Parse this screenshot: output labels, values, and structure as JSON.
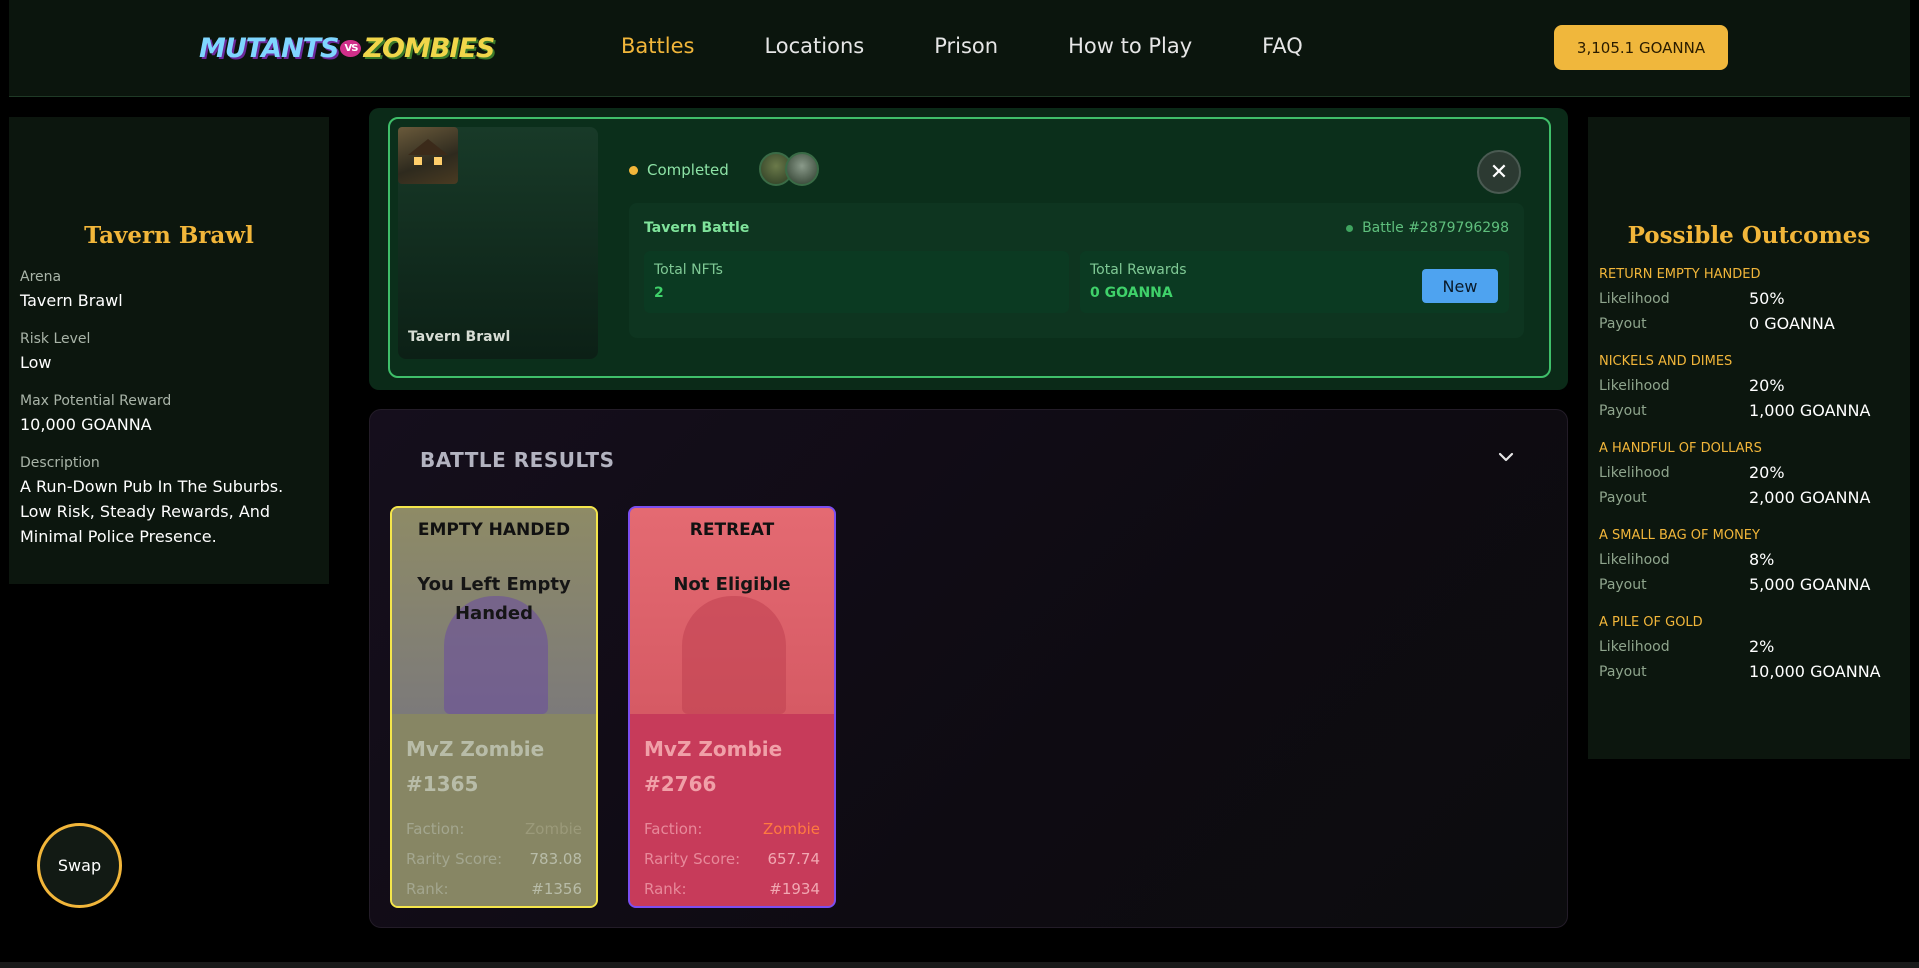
{
  "header": {
    "logo": {
      "part1": "MUTANTS",
      "part2": "VS",
      "part3": "ZOMBIES"
    },
    "nav": [
      {
        "label": "Battles",
        "active": true
      },
      {
        "label": "Locations",
        "active": false
      },
      {
        "label": "Prison",
        "active": false
      },
      {
        "label": "How to Play",
        "active": false
      },
      {
        "label": "FAQ",
        "active": false
      }
    ],
    "balance": "3,105.1 GOANNA"
  },
  "arena_panel": {
    "title": "Tavern Brawl",
    "arena_label": "Arena",
    "arena_value": "Tavern Brawl",
    "risk_label": "Risk Level",
    "risk_value": "Low",
    "reward_label": "Max Potential Reward",
    "reward_value": "10,000 GOANNA",
    "desc_label": "Description",
    "desc_value": "A Run-Down Pub In The Suburbs. Low Risk, Steady Rewards, And Minimal Police Presence."
  },
  "battle": {
    "arena_name": "Tavern Brawl",
    "status": "Completed",
    "name": "Tavern Battle",
    "id": "Battle #2879796298",
    "total_nfts_label": "Total NFTs",
    "total_nfts": "2",
    "total_rewards_label": "Total Rewards",
    "total_rewards": "0 GOANNA",
    "new_label": "New",
    "close_icon": "close-icon"
  },
  "results": {
    "title": "BATTLE RESULTS",
    "cards": [
      {
        "status": "EMPTY HANDED",
        "message": "You Left Empty Handed",
        "name": "MvZ Zombie #1365",
        "faction_label": "Faction:",
        "faction": "Zombie",
        "rarity_label": "Rarity Score:",
        "rarity": "783.08",
        "rank_label": "Rank:",
        "rank": "#1356"
      },
      {
        "status": "RETREAT",
        "message": "Not Eligible",
        "name": "MvZ Zombie #2766",
        "faction_label": "Faction:",
        "faction": "Zombie",
        "rarity_label": "Rarity Score:",
        "rarity": "657.74",
        "rank_label": "Rank:",
        "rank": "#1934"
      }
    ]
  },
  "outcomes": {
    "title": "Possible Outcomes",
    "likelihood_label": "Likelihood",
    "payout_label": "Payout",
    "items": [
      {
        "name": "RETURN EMPTY HANDED",
        "likelihood": "50%",
        "payout": "0 GOANNA"
      },
      {
        "name": "NICKELS AND DIMES",
        "likelihood": "20%",
        "payout": "1,000 GOANNA"
      },
      {
        "name": "A HANDFUL OF DOLLARS",
        "likelihood": "20%",
        "payout": "2,000 GOANNA"
      },
      {
        "name": "A SMALL BAG OF MONEY",
        "likelihood": "8%",
        "payout": "5,000 GOANNA"
      },
      {
        "name": "A PILE OF GOLD",
        "likelihood": "2%",
        "payout": "10,000 GOANNA"
      }
    ]
  },
  "swap_label": "Swap",
  "colors": {
    "accent": "#f2b63a",
    "success": "#3fd16a",
    "new_button": "#4ea3f0"
  }
}
